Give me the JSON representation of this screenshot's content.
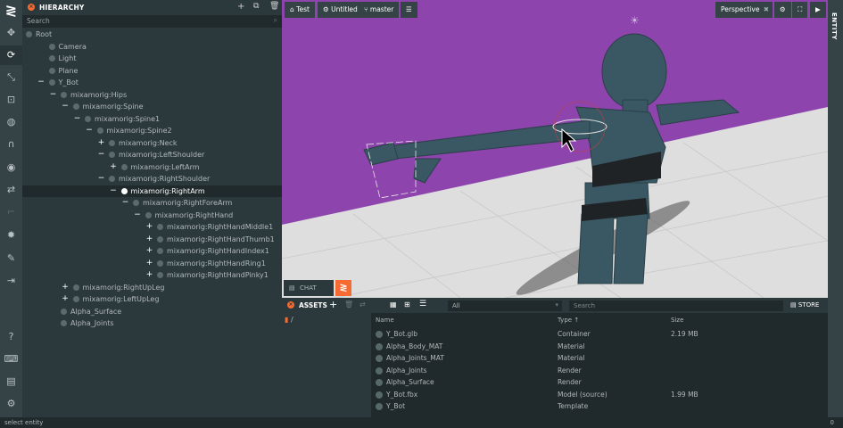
{
  "hierarchy": {
    "title": "HIERARCHY",
    "search_placeholder": "Search",
    "rows": [
      {
        "label": "Root",
        "indent": 0,
        "toggle": "",
        "icon": "entity-icon"
      },
      {
        "label": "Camera",
        "indent": 1,
        "toggle": "",
        "icon": "camera-icon"
      },
      {
        "label": "Light",
        "indent": 1,
        "toggle": "",
        "icon": "light-icon"
      },
      {
        "label": "Plane",
        "indent": 1,
        "toggle": "",
        "icon": "entity-icon"
      },
      {
        "label": "Y_Bot",
        "indent": 1,
        "toggle": "−",
        "icon": "template-icon"
      },
      {
        "label": "mixamorig:Hips",
        "indent": 2,
        "toggle": "−",
        "icon": "entity-icon"
      },
      {
        "label": "mixamorig:Spine",
        "indent": 3,
        "toggle": "−",
        "icon": "entity-icon"
      },
      {
        "label": "mixamorig:Spine1",
        "indent": 4,
        "toggle": "−",
        "icon": "entity-icon"
      },
      {
        "label": "mixamorig:Spine2",
        "indent": 5,
        "toggle": "−",
        "icon": "entity-icon"
      },
      {
        "label": "mixamorig:Neck",
        "indent": 6,
        "toggle": "+",
        "icon": "entity-icon"
      },
      {
        "label": "mixamorig:LeftShoulder",
        "indent": 6,
        "toggle": "−",
        "icon": "entity-icon"
      },
      {
        "label": "mixamorig:LeftArm",
        "indent": 7,
        "toggle": "+",
        "icon": "entity-icon"
      },
      {
        "label": "mixamorig:RightShoulder",
        "indent": 6,
        "toggle": "−",
        "icon": "entity-icon"
      },
      {
        "label": "mixamorig:RightArm",
        "indent": 7,
        "toggle": "−",
        "icon": "entity-icon",
        "selected": true
      },
      {
        "label": "mixamorig:RightForeArm",
        "indent": 8,
        "toggle": "−",
        "icon": "entity-icon"
      },
      {
        "label": "mixamorig:RightHand",
        "indent": 9,
        "toggle": "−",
        "icon": "entity-icon"
      },
      {
        "label": "mixamorig:RightHandMiddle1",
        "indent": 10,
        "toggle": "+",
        "icon": "entity-icon"
      },
      {
        "label": "mixamorig:RightHandThumb1",
        "indent": 10,
        "toggle": "+",
        "icon": "entity-icon"
      },
      {
        "label": "mixamorig:RightHandIndex1",
        "indent": 10,
        "toggle": "+",
        "icon": "entity-icon"
      },
      {
        "label": "mixamorig:RightHandRing1",
        "indent": 10,
        "toggle": "+",
        "icon": "entity-icon"
      },
      {
        "label": "mixamorig:RightHandPinky1",
        "indent": 10,
        "toggle": "+",
        "icon": "entity-icon"
      },
      {
        "label": "mixamorig:RightUpLeg",
        "indent": 3,
        "toggle": "+",
        "icon": "entity-icon"
      },
      {
        "label": "mixamorig:LeftUpLeg",
        "indent": 3,
        "toggle": "+",
        "icon": "entity-icon"
      },
      {
        "label": "Alpha_Surface",
        "indent": 2,
        "toggle": "",
        "icon": "entity-icon"
      },
      {
        "label": "Alpha_Joints",
        "indent": 2,
        "toggle": "",
        "icon": "entity-icon"
      }
    ]
  },
  "toolbar": {
    "items": [
      "select-icon",
      "translate-icon",
      "rotate-icon",
      "scale-icon",
      "resize-icon",
      "world-icon",
      "snap-icon",
      "view-icon",
      "bake-icon",
      "collapse-icon",
      "light-icon",
      "edit-icon",
      "publish-icon",
      "help-icon",
      "keyboard-icon",
      "chat-icon",
      "settings-icon"
    ]
  },
  "viewport": {
    "project": "Test",
    "scene": "Untitled",
    "branch": "master",
    "camera": "Perspective"
  },
  "entity_panel_label": "ENTITY",
  "chat_label": "CHAT",
  "assets": {
    "title": "ASSETS",
    "filter": "All",
    "search_placeholder": "Search",
    "store_label": "STORE",
    "folder": "/",
    "columns": {
      "name": "Name",
      "type": "Type",
      "size": "Size"
    },
    "rows": [
      {
        "name": "Y_Bot.glb",
        "type": "Container",
        "size": "2.19 MB",
        "icon": "container-icon"
      },
      {
        "name": "Alpha_Body_MAT",
        "type": "Material",
        "size": "",
        "icon": "material-icon"
      },
      {
        "name": "Alpha_Joints_MAT",
        "type": "Material",
        "size": "",
        "icon": "material-icon"
      },
      {
        "name": "Alpha_Joints",
        "type": "Render",
        "size": "",
        "icon": "render-icon"
      },
      {
        "name": "Alpha_Surface",
        "type": "Render",
        "size": "",
        "icon": "render-icon"
      },
      {
        "name": "Y_Bot.fbx",
        "type": "Model (source)",
        "size": "1.99 MB",
        "icon": "model-icon"
      },
      {
        "name": "Y_Bot",
        "type": "Template",
        "size": "",
        "icon": "template-icon"
      }
    ]
  },
  "status": {
    "text": "select entity",
    "count": "0"
  },
  "colors": {
    "accent": "#f56b31",
    "sky": "#8e44ad",
    "panel": "#2c393c"
  }
}
